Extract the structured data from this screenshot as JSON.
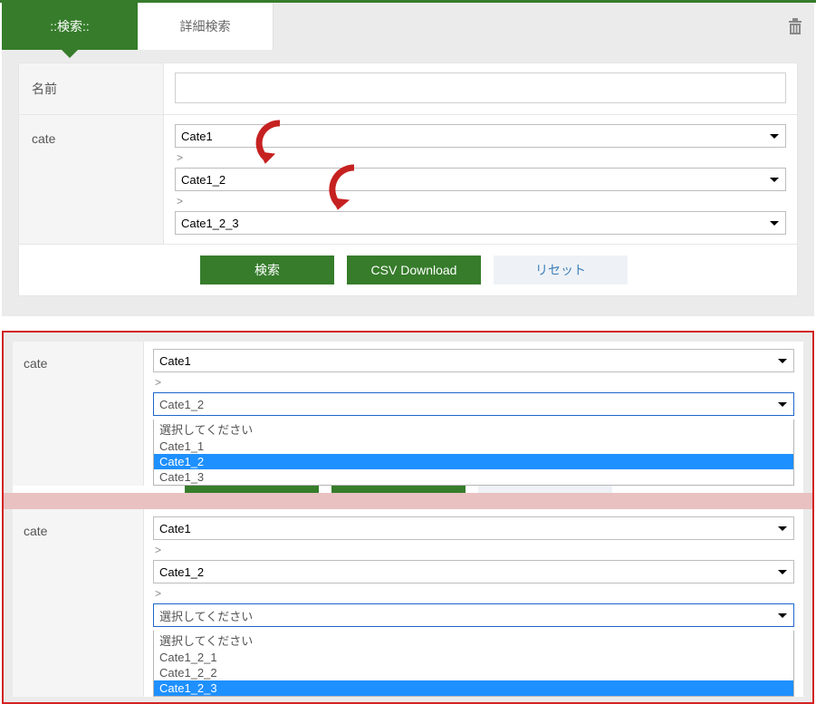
{
  "tabs": {
    "search": "::検索::",
    "advanced": "詳細検索"
  },
  "trash_icon": "trash-icon",
  "form": {
    "name_label": "名前",
    "cate_label": "cate",
    "cate_sel1": "Cate1",
    "gt": ">",
    "cate_sel2": "Cate1_2",
    "cate_sel3": "Cate1_2_3"
  },
  "buttons": {
    "search": "検索",
    "csv": "CSV Download",
    "reset": "リセット"
  },
  "panel2": {
    "cate_label": "cate",
    "sel1": "Cate1",
    "gt": ">",
    "sel2_value": "Cate1_2",
    "sel2_options": {
      "o0": "選択してください",
      "o1": "Cate1_1",
      "o2": "Cate1_2",
      "o3": "Cate1_3"
    },
    "sel2_highlight": "o2"
  },
  "panel3": {
    "cate_label": "cate",
    "sel1": "Cate1",
    "gt": ">",
    "sel2": "Cate1_2",
    "sel3_value": "選択してください",
    "sel3_options": {
      "o0": "選択してください",
      "o1": "Cate1_2_1",
      "o2": "Cate1_2_2",
      "o3": "Cate1_2_3"
    },
    "sel3_highlight": "o3"
  }
}
